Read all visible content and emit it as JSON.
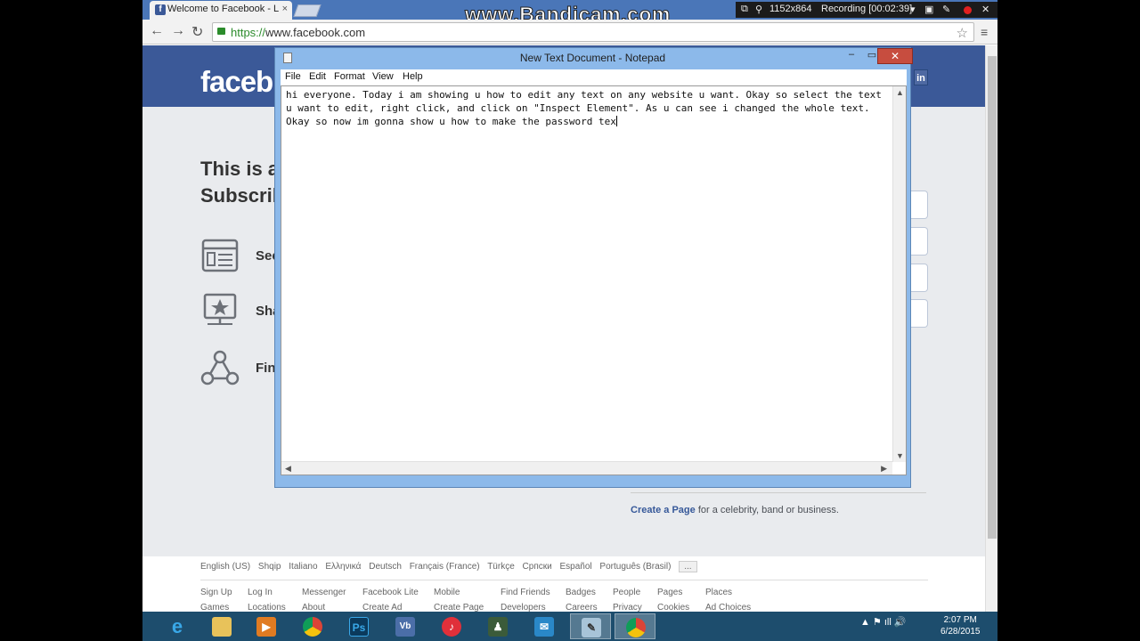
{
  "browser": {
    "tab_title": "Welcome to Facebook - L",
    "tab_close": "×",
    "back": "←",
    "forward": "→",
    "reload": "↻",
    "url_scheme": "https://",
    "url_host": "www.facebook.com",
    "bookmark_star": "☆",
    "menu": "≡"
  },
  "recorder": {
    "watermark": "www.Bandicam.com",
    "resolution": "1152x864",
    "status": "Recording [00:02:39]"
  },
  "facebook": {
    "logo": "faceb",
    "login_stub": "in",
    "title_line1": "This is a",
    "title_line2": "Subscrib",
    "features": [
      {
        "label": "See",
        "icon": "news-feed-icon"
      },
      {
        "label": "Sha",
        "icon": "share-star-icon"
      },
      {
        "label": "Fin",
        "icon": "find-friends-icon"
      }
    ],
    "create_page_link": "Create a Page",
    "create_page_rest": " for a celebrity, band or business.",
    "languages": [
      "English (US)",
      "Shqip",
      "Italiano",
      "Ελληνικά",
      "Deutsch",
      "Français (France)",
      "Türkçe",
      "Српски",
      "Español",
      "Português (Brasil)"
    ],
    "more_languages": "...",
    "footer_row1": [
      "Sign Up",
      "Log In",
      "Messenger",
      "Facebook Lite",
      "Mobile",
      "Find Friends",
      "Badges",
      "People",
      "Pages",
      "Places"
    ],
    "footer_row2": [
      "Games",
      "Locations",
      "About",
      "Create Ad",
      "Create Page",
      "Developers",
      "Careers",
      "Privacy",
      "Cookies",
      "Ad Choices"
    ]
  },
  "notepad": {
    "title": "New Text Document - Notepad",
    "min": "–",
    "max": "▭",
    "close": "✕",
    "menus": [
      "File",
      "Edit",
      "Format",
      "View",
      "Help"
    ],
    "content": "hi everyone. Today i am showing u how to edit any text on any website u want. Okay so select the text\nu want to edit, right click, and click on \"Inspect Element\". As u can see i changed the whole text.\nOkay so now im gonna show u how to make the password tex"
  },
  "taskbar": {
    "apps": [
      "ie",
      "explorer",
      "media",
      "chrome",
      "photoshop",
      "vb",
      "itunes",
      "game",
      "mail",
      "notepad",
      "chrome2"
    ],
    "tray": "▲  ⚑  ıll  🔊",
    "time": "2:07 PM",
    "date": "6/28/2015"
  },
  "colors": {
    "facebook_blue": "#3b5998",
    "chrome_frame": "#4a76b8",
    "notepad_frame": "#8cb9ea",
    "taskbar": "#1d4d6d"
  }
}
